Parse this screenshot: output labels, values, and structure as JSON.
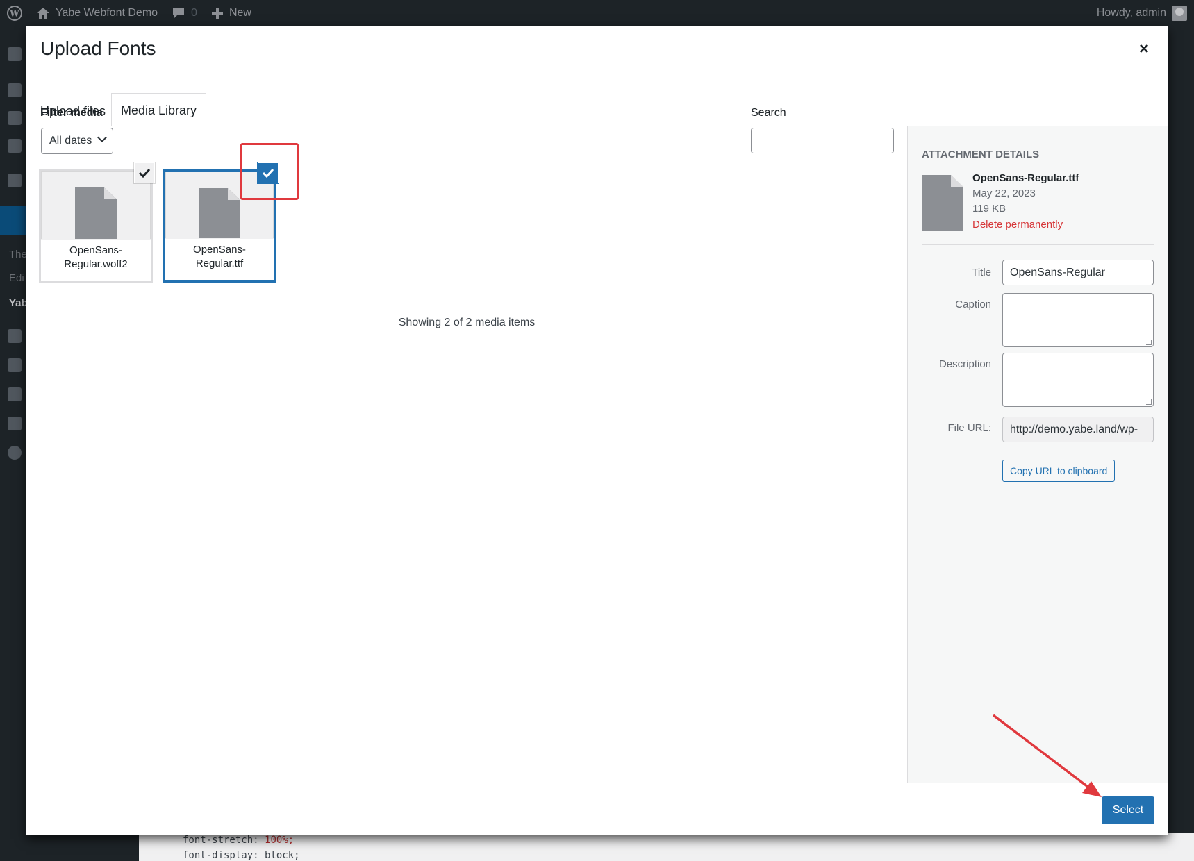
{
  "admin_bar": {
    "site_name": "Yabe Webfont Demo",
    "comments_count": "0",
    "new_label": "New",
    "greeting": "Howdy, admin"
  },
  "admin_menu": {
    "partial_items": [
      "The",
      "Edi",
      "Yab"
    ]
  },
  "background_code": {
    "line1_prop": "font-stretch:",
    "line1_val": "100%;",
    "line2_prop": "font-display:",
    "line2_val": "block;"
  },
  "modal": {
    "title": "Upload Fonts",
    "close_label": "×",
    "tabs": [
      {
        "label": "Upload files",
        "active": false
      },
      {
        "label": "Media Library",
        "active": true
      }
    ],
    "filter": {
      "label": "Filter media",
      "selected": "All dates"
    },
    "search": {
      "label": "Search",
      "value": ""
    },
    "attachments": [
      {
        "filename_line1": "OpenSans-",
        "filename_line2": "Regular.woff2",
        "selected": false
      },
      {
        "filename_line1": "OpenSans-",
        "filename_line2": "Regular.ttf",
        "selected": true
      }
    ],
    "showing_text": "Showing 2 of 2 media items",
    "details": {
      "heading": "Attachment Details",
      "filename": "OpenSans-Regular.ttf",
      "date": "May 22, 2023",
      "size": "119 KB",
      "delete_label": "Delete permanently",
      "title_label": "Title",
      "title_value": "OpenSans-Regular",
      "caption_label": "Caption",
      "description_label": "Description",
      "url_label": "File URL:",
      "url_value": "http://demo.yabe.land/wp-",
      "copy_label": "Copy URL to clipboard"
    },
    "select_label": "Select"
  },
  "colors": {
    "accent": "#2271b1",
    "delete": "#d63638",
    "annotation": "#e0393e"
  }
}
